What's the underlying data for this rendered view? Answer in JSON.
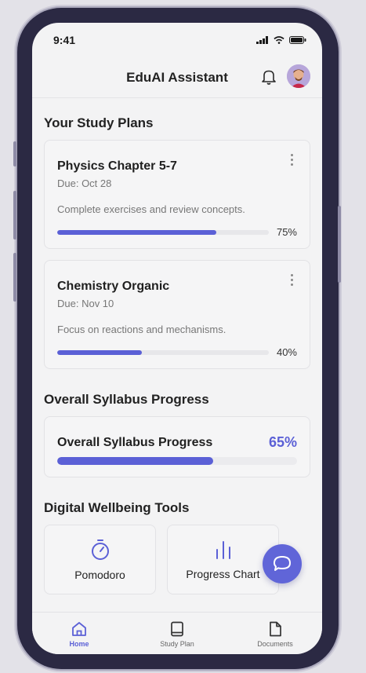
{
  "status_bar": {
    "time": "9:41"
  },
  "header": {
    "title": "EduAI Assistant"
  },
  "study_plans": {
    "title": "Your Study Plans",
    "plans": [
      {
        "title": "Physics Chapter 5-7",
        "due": "Due: Oct 28",
        "description": "Complete exercises and review concepts.",
        "progress_label": "75%",
        "progress": 0.75
      },
      {
        "title": "Chemistry Organic",
        "due": "Due: Nov 10",
        "description": "Focus on reactions and mechanisms.",
        "progress_label": "40%",
        "progress": 0.4
      }
    ]
  },
  "syllabus": {
    "section_title": "Overall Syllabus Progress",
    "card_label": "Overall Syllabus Progress",
    "progress_label": "65%",
    "progress": 0.65
  },
  "wellbeing": {
    "title": "Digital Wellbeing Tools",
    "tools": [
      {
        "label": "Pomodoro",
        "icon": "timer-icon"
      },
      {
        "label": "Progress Chart",
        "icon": "bar-chart-icon"
      }
    ]
  },
  "nav": {
    "items": [
      {
        "label": "Home",
        "icon": "home-icon",
        "active": true
      },
      {
        "label": "Study Plan",
        "icon": "book-icon",
        "active": false
      },
      {
        "label": "Documents",
        "icon": "document-icon",
        "active": false
      }
    ]
  },
  "colors": {
    "accent": "#5b60d6",
    "frame": "#2b2943"
  }
}
